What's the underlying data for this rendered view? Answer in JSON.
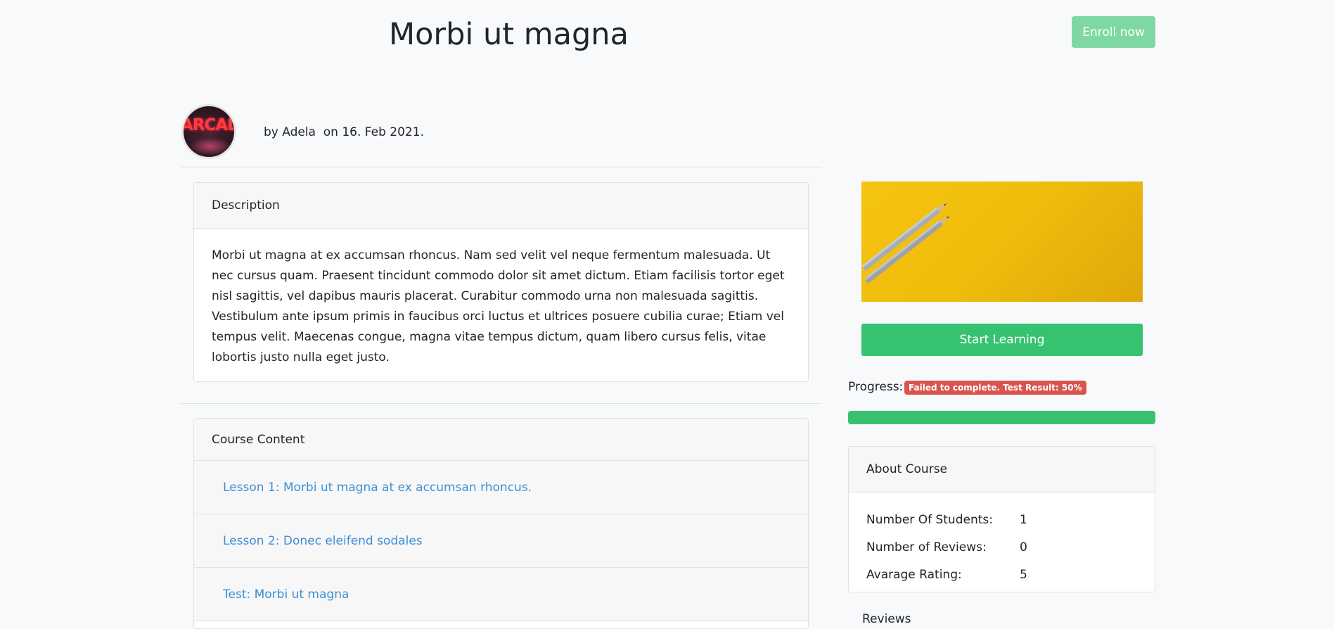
{
  "header": {
    "title": "Morbi ut magna",
    "enroll_label": "Enroll now"
  },
  "author": {
    "byline": "by Adela  on 16. Feb 2021.",
    "avatar_text": "ARCADE"
  },
  "description": {
    "heading": "Description",
    "body": "Morbi ut magna at ex accumsan rhoncus. Nam sed velit vel neque fermentum malesuada. Ut nec cursus quam. Praesent tincidunt commodo dolor sit amet dictum. Etiam facilisis tortor eget nisl sagittis, vel dapibus mauris placerat. Curabitur commodo urna non malesuada sagittis. Vestibulum ante ipsum primis in faucibus orci luctus et ultrices posuere cubilia curae; Etiam vel tempus velit. Maecenas congue, magna vitae tempus dictum, quam libero cursus felis, vitae lobortis justo nulla eget justo."
  },
  "content": {
    "heading": "Course Content",
    "items": [
      {
        "label": "Lesson 1: Morbi ut magna at ex accumsan rhoncus."
      },
      {
        "label": "Lesson 2: Donec eleifend sodales"
      },
      {
        "label": "Test: Morbi ut magna"
      }
    ]
  },
  "sidebar": {
    "start_label": "Start Learning",
    "progress_label": "Progress:",
    "progress_badge": "Failed to complete. Test Result: 50%",
    "progress_fraction": 1.0,
    "about": {
      "heading": "About Course",
      "rows": [
        {
          "key": "Number Of Students:",
          "value": "1"
        },
        {
          "key": "Number of Reviews:",
          "value": "0"
        },
        {
          "key": "Avarage Rating:",
          "value": "5"
        }
      ]
    },
    "cut_text": "Reviews"
  },
  "colors": {
    "primary_green": "#37c270",
    "enroll_green": "#7fd8a4",
    "link_blue": "#3d8fd6",
    "danger_red": "#d9534f",
    "course_image_yellow": "#f5c312"
  },
  "icons": [
    "pencil-icon"
  ]
}
